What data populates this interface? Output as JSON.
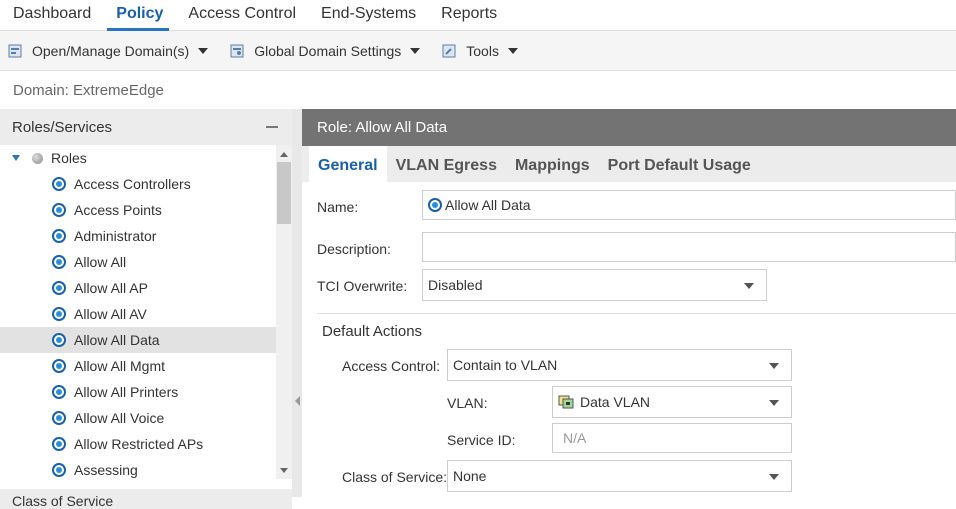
{
  "nav": {
    "tabs": [
      {
        "label": "Dashboard"
      },
      {
        "label": "Policy"
      },
      {
        "label": "Access Control"
      },
      {
        "label": "End-Systems"
      },
      {
        "label": "Reports"
      }
    ],
    "active_color": "#1a5fa8"
  },
  "toolbar": {
    "open_manage": "Open/Manage Domain(s)",
    "global_settings": "Global Domain Settings",
    "tools": "Tools"
  },
  "domain": {
    "label": "Domain: ExtremeEdge"
  },
  "left_panel": {
    "title": "Roles/Services",
    "root": "Roles",
    "roles": [
      "Access Controllers",
      "Access Points",
      "Administrator",
      "Allow All",
      "Allow All AP",
      "Allow All AV",
      "Allow All Data",
      "Allow All Mgmt",
      "Allow All Printers",
      "Allow All Voice",
      "Allow Restricted APs",
      "Assessing"
    ],
    "selected": "Allow All Data",
    "footer": "Class of Service"
  },
  "right_panel": {
    "title": "Role: Allow All Data",
    "tabs": [
      "General",
      "VLAN Egress",
      "Mappings",
      "Port Default Usage"
    ],
    "name_label": "Name:",
    "name_value": "Allow All Data",
    "description_label": "Description:",
    "description_value": "",
    "tci_label": "TCI Overwrite:",
    "tci_value": "Disabled",
    "default_actions_title": "Default Actions",
    "access_control_label": "Access Control:",
    "access_control_value": "Contain to VLAN",
    "vlan_label": "VLAN:",
    "vlan_value": "Data VLAN",
    "service_id_label": "Service ID:",
    "service_id_value": "N/A",
    "cos_label": "Class of Service:",
    "cos_value": "None"
  }
}
